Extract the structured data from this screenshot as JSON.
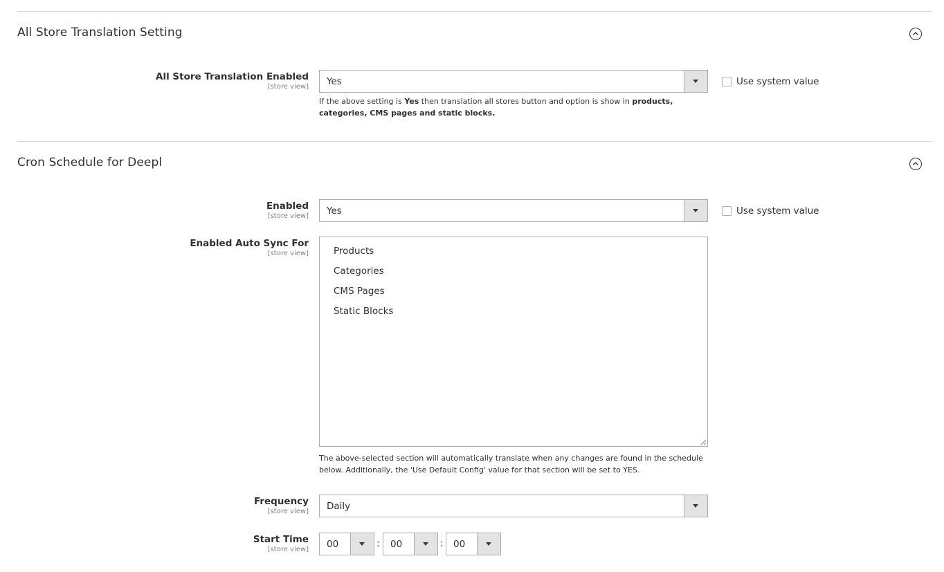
{
  "section1": {
    "title": "All Store Translation Setting",
    "field": {
      "label": "All Store Translation Enabled",
      "scope": "[store view]",
      "value": "Yes",
      "use_system_value": "Use system value"
    },
    "note": {
      "p1": "If the above setting is ",
      "b1": "Yes",
      "p2": " then translation all stores button and option is show in ",
      "b2": "products, categories, CMS pages and static blocks."
    }
  },
  "section2": {
    "title": "Cron Schedule for Deepl",
    "enabled": {
      "label": "Enabled",
      "scope": "[store view]",
      "value": "Yes",
      "use_system_value": "Use system value"
    },
    "auto_sync": {
      "label": "Enabled Auto Sync For",
      "scope": "[store view]",
      "options": [
        "Products",
        "Categories",
        "CMS Pages",
        "Static Blocks"
      ],
      "note": "The above-selected section will automatically translate when any changes are found in the schedule below. Additionally, the 'Use Default Config' value for that section will be set to YES."
    },
    "frequency": {
      "label": "Frequency",
      "scope": "[store view]",
      "value": "Daily"
    },
    "start_time": {
      "label": "Start Time",
      "scope": "[store view]",
      "hour": "00",
      "minute": "00",
      "second": "00",
      "separator": ":"
    }
  },
  "icons": {
    "collapse": "chevron-up-circle-icon",
    "dropdown": "triangle-down-icon"
  },
  "colors": {
    "text": "#303030",
    "border": "#adadad",
    "arrow_bg": "#e3e3e3",
    "scope": "#808080"
  }
}
